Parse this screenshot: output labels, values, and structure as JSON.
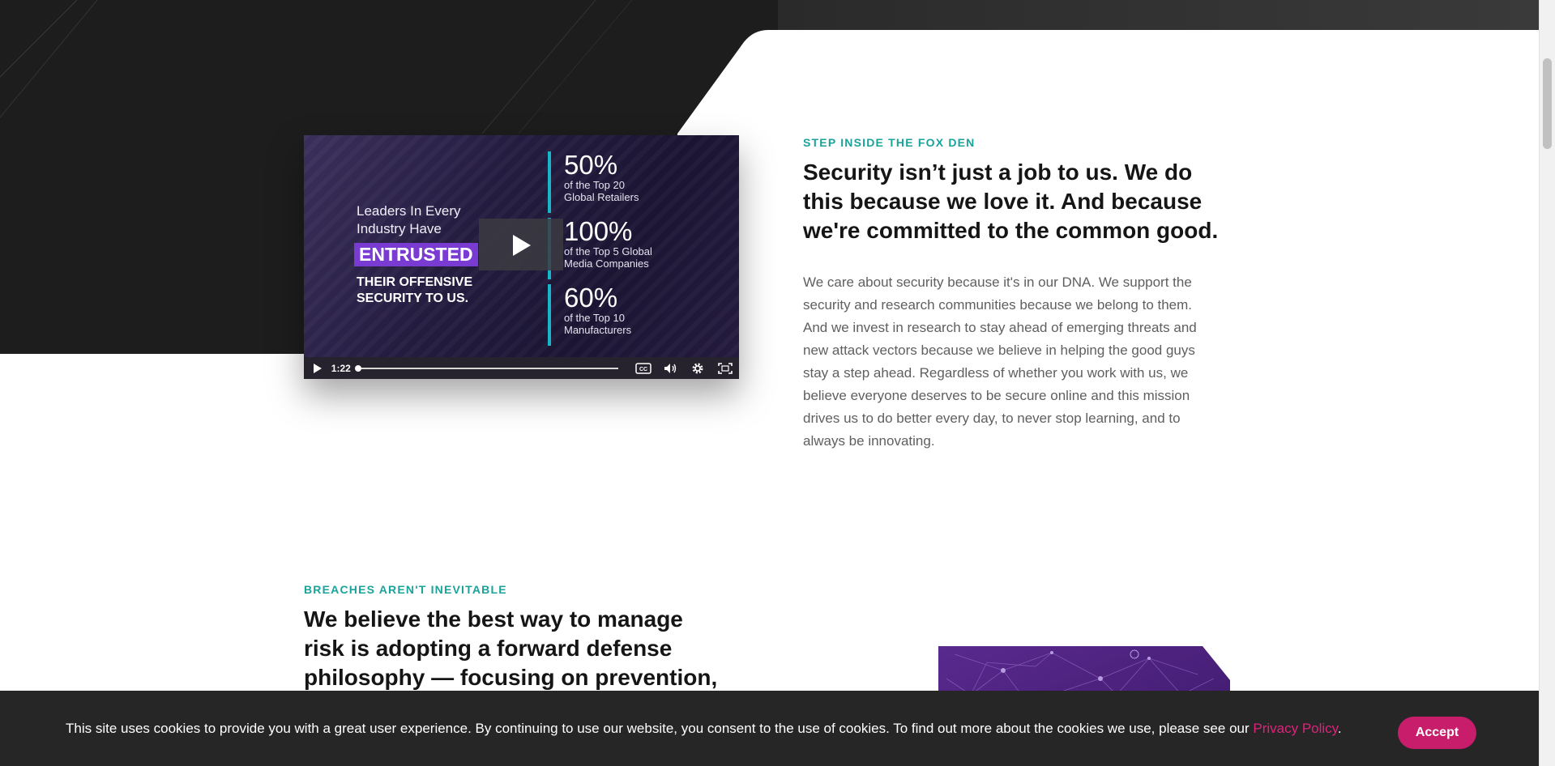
{
  "video": {
    "lead_line1": "Leaders In Every",
    "lead_line2": "Industry Have",
    "entrusted": "ENTRUSTED",
    "their_line1": "THEIR OFFENSIVE",
    "their_line2": "SECURITY TO US.",
    "stats": [
      {
        "pct": "50%",
        "line1": "of the Top 20",
        "line2": "Global Retailers"
      },
      {
        "pct": "100%",
        "line1": "of the Top 5 Global",
        "line2": "Media Companies"
      },
      {
        "pct": "60%",
        "line1": "of the Top 10",
        "line2": "Manufacturers"
      }
    ],
    "time": "1:22",
    "progress": 0,
    "icons": [
      "play-icon",
      "captions-icon",
      "volume-icon",
      "settings-icon",
      "fullscreen-icon"
    ]
  },
  "section1": {
    "eyebrow": "STEP INSIDE THE FOX DEN",
    "heading_lines": [
      "Security isn’t just a job to us. We do",
      "this because we love it. And because",
      "we're committed to the common good."
    ],
    "body_lines": [
      "We care about security because it's in our DNA. We support the",
      "security and research communities because we belong to them.",
      "And we invest in research to stay ahead of emerging threats and",
      "new attack vectors because we believe in helping the good guys",
      "stay a step ahead. Regardless of whether you work with us, we",
      "believe everyone deserves to be secure online and this mission",
      "drives us to do better every day, to never stop learning, and to",
      "always be innovating."
    ]
  },
  "section2": {
    "eyebrow": "BREACHES AREN'T INEVITABLE",
    "heading_lines": [
      "We believe the best way to manage",
      "risk is adopting a forward defense",
      "philosophy — focusing on prevention,"
    ]
  },
  "cookie": {
    "text": "This site uses cookies to provide you with a great user experience. By continuing to use our website, you consent to the use of cookies. To find out more about the cookies we use, please see our ",
    "link": "Privacy Policy",
    "after_link": ".",
    "accept": "Accept"
  },
  "colors": {
    "accent_teal": "#1aa39a",
    "accent_pink": "#c71d6b",
    "dark_band": "#1d1d1d",
    "purple": "#7a3bd3"
  }
}
